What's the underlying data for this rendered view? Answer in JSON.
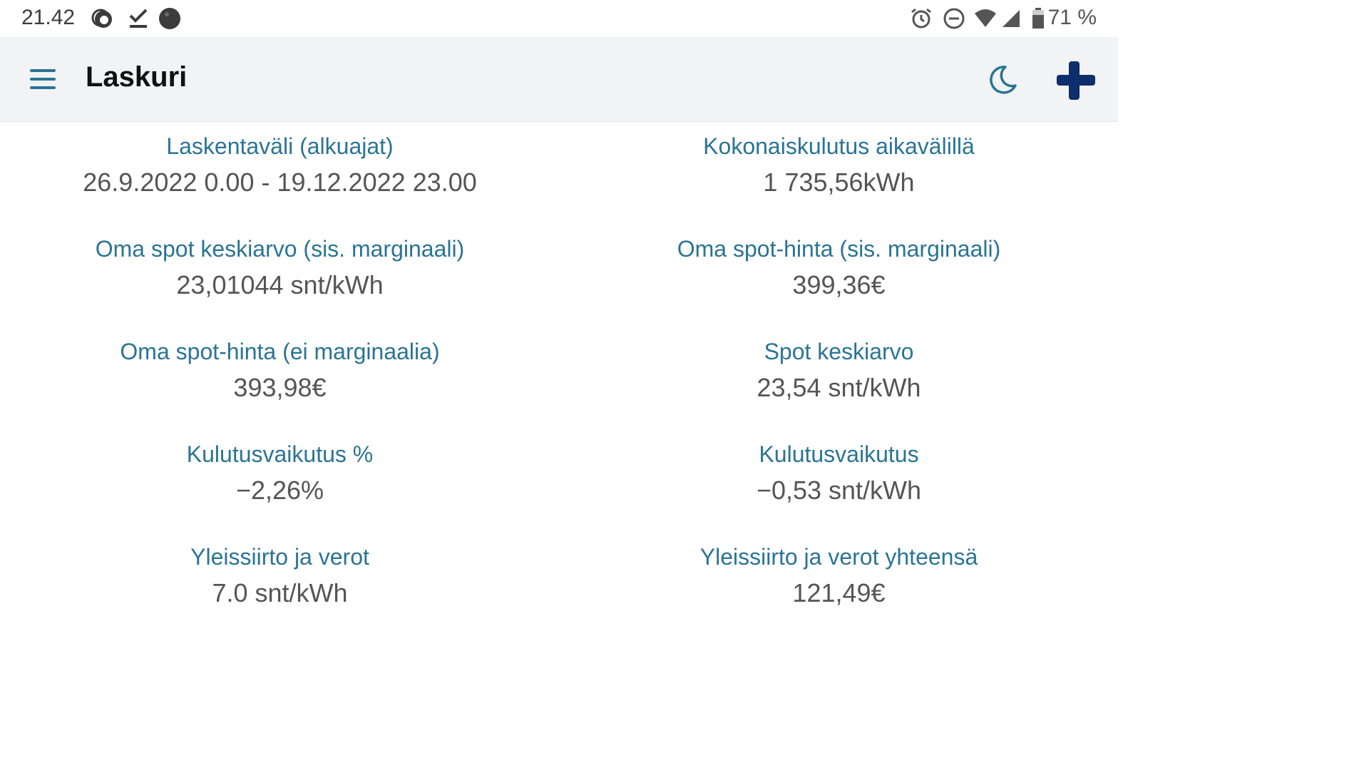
{
  "status_bar": {
    "time": "21.42",
    "battery_percent": "71 %",
    "icons": [
      "notification-app-icon",
      "download-done-icon",
      "circle-dot-icon",
      "alarm-icon",
      "do-not-disturb-icon",
      "wifi-icon",
      "signal-icon",
      "battery-icon"
    ]
  },
  "app_bar": {
    "title": "Laskuri",
    "menu_icon": "hamburger-menu-icon",
    "theme_icon": "moon-icon",
    "language_icon": "finnish-flag-icon",
    "accent_color": "#2a7494",
    "flag_color": "#0d2d6c"
  },
  "stats": [
    {
      "label": "Laskentaväli (alkuajat)",
      "value": "26.9.2022 0.00 - 19.12.2022 23.00"
    },
    {
      "label": "Kokonaiskulutus aikavälillä",
      "value": "1 735,56kWh"
    },
    {
      "label": "Oma spot keskiarvo (sis. marginaali)",
      "value": "23,01044 snt/kWh"
    },
    {
      "label": "Oma spot-hinta (sis. marginaali)",
      "value": "399,36€"
    },
    {
      "label": "Oma spot-hinta (ei marginaalia)",
      "value": "393,98€"
    },
    {
      "label": "Spot keskiarvo",
      "value": "23,54 snt/kWh"
    },
    {
      "label": "Kulutusvaikutus %",
      "value": "−2,26%"
    },
    {
      "label": "Kulutusvaikutus",
      "value": "−0,53 snt/kWh"
    },
    {
      "label": "Yleissiirto ja verot",
      "value": "7.0 snt/kWh"
    },
    {
      "label": "Yleissiirto ja verot yhteensä",
      "value": "121,49€"
    }
  ]
}
